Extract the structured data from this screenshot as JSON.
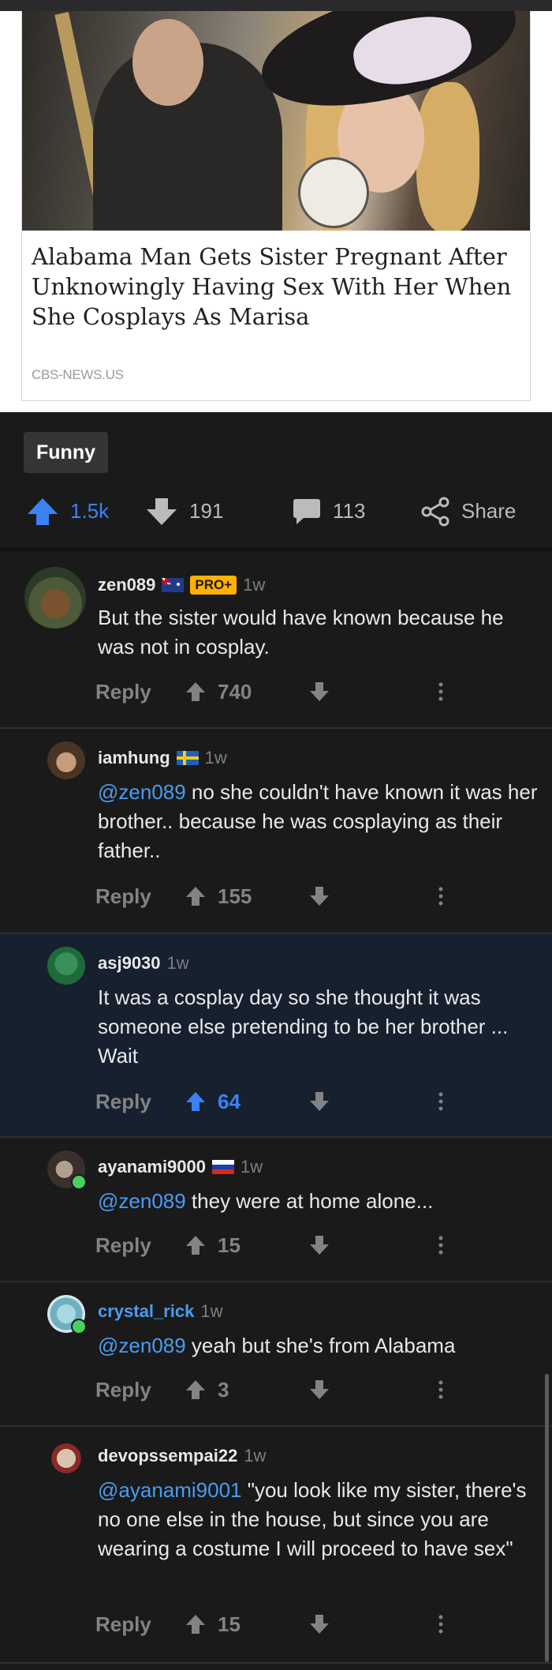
{
  "post": {
    "headline": "Alabama Man Gets Sister Pregnant After Unknowingly Having Sex With Her When She Cosplays As Marisa",
    "source": "CBS-NEWS.US",
    "flair": "Funny",
    "upvotes": "1.5k",
    "downvotes": "191",
    "comments": "113",
    "share_label": "Share"
  },
  "colors": {
    "accent_blue": "#3b82f6",
    "pro_badge": "#ffb000",
    "mention": "#4a9cf0"
  },
  "comments": [
    {
      "username": "zen089",
      "flag": "australia",
      "badge": "PRO+",
      "time": "1w",
      "text": "But the sister would have known because he was not in cosplay.",
      "reply": "Reply",
      "score": "740"
    },
    {
      "username": "iamhung",
      "flag": "sweden",
      "time": "1w",
      "mention": "@zen089",
      "text": " no she couldn't have known it was her brother.. because he was cosplaying as their father..",
      "reply": "Reply",
      "score": "155"
    },
    {
      "username": "asj9030",
      "time": "1w",
      "text": "It was a cosplay day so she thought it was someone else pretending to be her brother ... Wait",
      "reply": "Reply",
      "score": "64",
      "upvoted": true
    },
    {
      "username": "ayanami9000",
      "flag": "russia",
      "time": "1w",
      "mention": "@zen089",
      "text": " they were at home alone...",
      "reply": "Reply",
      "score": "15"
    },
    {
      "username": "crystal_rick",
      "time": "1w",
      "mention": "@zen089",
      "text": " yeah but she's from Alabama",
      "reply": "Reply",
      "score": "3"
    },
    {
      "username": "devopssempai22",
      "time": "1w",
      "mention": "@ayanami9001",
      "text": " \"you look like my sister, there's no one else in the house, but since you are wearing a costume I will proceed to have sex\"",
      "reply": "Reply",
      "score": "15"
    }
  ]
}
